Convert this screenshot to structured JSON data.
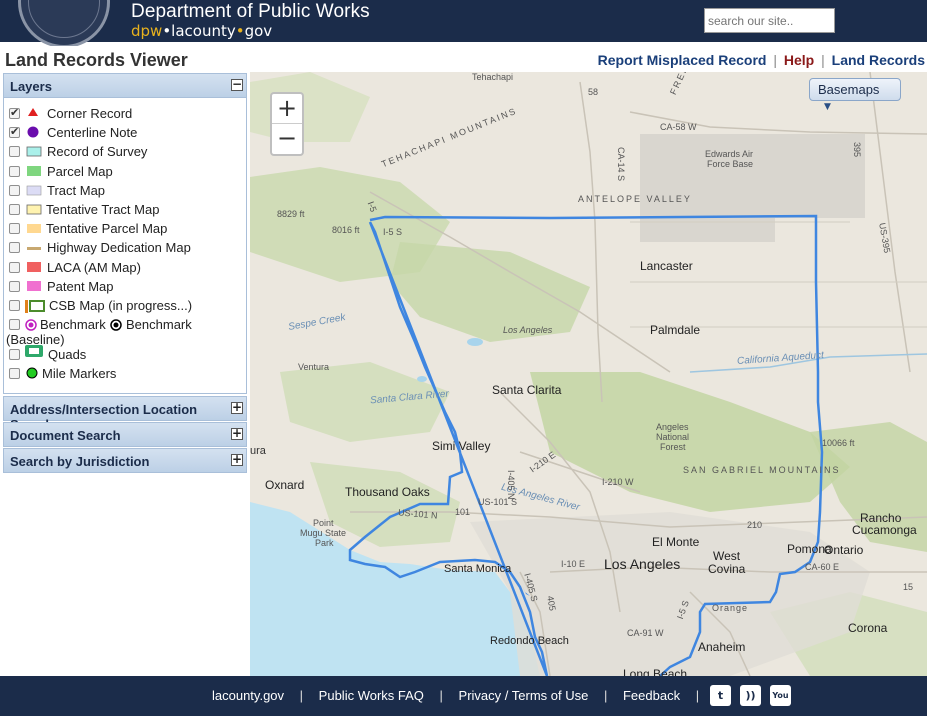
{
  "header": {
    "title": "Department of Public Works",
    "url_dpw": "dpw",
    "url_dot1": "•",
    "url_la": "lacounty",
    "url_dot2": "•",
    "url_gov": "gov",
    "search_placeholder": "search our site.."
  },
  "page": {
    "title": "Land Records Viewer",
    "links": [
      "Report Misplaced Record",
      "Help",
      "Land Records"
    ],
    "link_sep": "|"
  },
  "panel": {
    "layers_title": "Layers",
    "layers_toggle": "−",
    "layers": [
      {
        "label": "Corner Record",
        "checked": true,
        "symbol": "red-triangle-icon",
        "color": "#e02020"
      },
      {
        "label": "Centerline Note",
        "checked": true,
        "symbol": "purple-circle-icon",
        "color": "#6a0dad"
      },
      {
        "label": "Record of Survey",
        "checked": false,
        "symbol": "cyan-swatch-icon",
        "color": "#aaf0ea"
      },
      {
        "label": "Parcel Map",
        "checked": false,
        "symbol": "green-swatch-icon",
        "color": "#7fd67f"
      },
      {
        "label": "Tract Map",
        "checked": false,
        "symbol": "lavender-swatch-icon",
        "color": "#dcdcf5"
      },
      {
        "label": "Tentative Tract Map",
        "checked": false,
        "symbol": "yellow-swatch-icon",
        "color": "#fff3b0"
      },
      {
        "label": "Tentative Parcel Map",
        "checked": false,
        "symbol": "orange-swatch-icon",
        "color": "#ffd890"
      },
      {
        "label": "Highway Dedication Map",
        "checked": false,
        "symbol": "tan-line-icon",
        "color": "#c8a870"
      },
      {
        "label": "LACA (AM Map)",
        "checked": false,
        "symbol": "red-swatch-icon",
        "color": "#f06060"
      },
      {
        "label": "Patent Map",
        "checked": false,
        "symbol": "pink-swatch-icon",
        "color": "#f070d0"
      },
      {
        "label": "CSB Map (in progress...)",
        "checked": false,
        "symbol": "csb-icon",
        "color": "#4c8c2c"
      }
    ],
    "benchmark_a": "Benchmark",
    "benchmark_b": "Benchmark",
    "benchmark_c": "(Baseline)",
    "quads": "Quads",
    "mile_markers": "Mile Markers",
    "sections": [
      {
        "label": "Address/Intersection Location Search",
        "toggle": "+"
      },
      {
        "label": "Document Search",
        "toggle": "+"
      },
      {
        "label": "Search by Jurisdiction",
        "toggle": "+"
      }
    ]
  },
  "map": {
    "zoom_in": "+",
    "zoom_out": "−",
    "basemaps": "Basemaps",
    "basemaps_caret": "▼",
    "labels": {
      "tehachapi": "Tehachapi",
      "tehachapi_mtns": "TEHACHAPI MOUNTAINS",
      "edwards": "Edwards Air",
      "edwards2": "Force Base",
      "antelope": "ANTELOPE VALLEY",
      "lancaster": "Lancaster",
      "palmdale": "Palmdale",
      "elev1": "8829 ft",
      "elev2": "8016 ft",
      "elev3": "10066 ft",
      "los_angeles_mtn": "Los Angeles",
      "sespe": "Sespe Creek",
      "ventura": "Ventura",
      "santa_clarita": "Santa Clarita",
      "santa_clara_river": "Santa Clara River",
      "ca_aqueduct": "California Aqueduct",
      "simi": "Simi Valley",
      "oxnard": "Oxnard",
      "thousand_oaks": "Thousand Oaks",
      "angeles_forest": "Angeles",
      "angeles_forest2": "National",
      "angeles_forest3": "Forest",
      "san_gabriel": "SAN GABRIEL MOUNTAINS",
      "point_mugu": "Point",
      "point_mugu2": "Mugu State",
      "point_mugu3": "Park",
      "santa_monica": "Santa Monica",
      "la_city": "Los Angeles",
      "el_monte": "El Monte",
      "west_covina": "West",
      "west_covina2": "Covina",
      "pomona": "Pomona",
      "ontario": "Ontario",
      "rancho": "Rancho",
      "rancho2": "Cucamonga",
      "la_river": "Los Angeles River",
      "redondo": "Redondo Beach",
      "anaheim": "Anaheim",
      "orange": "Orange",
      "corona": "Corona",
      "long_beach": "Long Beach",
      "ura": "ura",
      "r_58": "58",
      "ca58": "CA-58 W",
      "ca14": "CA-14 S",
      "us395": "US-395",
      "r395": "395",
      "i5": "I-5 S",
      "i5b": "I-5",
      "i210": "I-210 E",
      "i210w": "I-210 W",
      "i405": "I-405 N",
      "us101": "US-101 N",
      "r101": "101",
      "us101s": "US-101 S",
      "r210": "210",
      "i10": "I-10 E",
      "ca60": "CA-60 E",
      "i405s": "I-405 S",
      "r405": "405",
      "ca91": "CA-91 W",
      "i5s": "I-5 S",
      "r15": "15",
      "fremont": "FREM"
    }
  },
  "footer": {
    "links": [
      "lacounty.gov",
      "Public Works FAQ",
      "Privacy / Terms of Use",
      "Feedback"
    ],
    "sep": "|",
    "twitter": "t",
    "rss": "))",
    "youtube": "You"
  }
}
